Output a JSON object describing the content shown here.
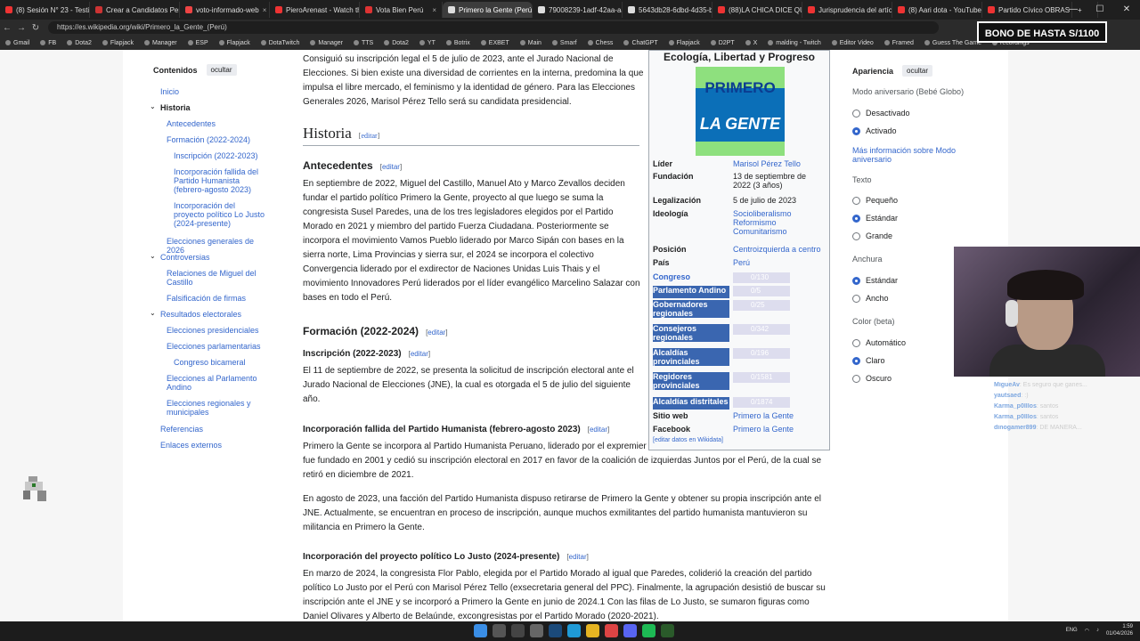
{
  "browser": {
    "tabs": [
      {
        "label": "(8) Sesión N° 23 - Testim...",
        "color": "#e33"
      },
      {
        "label": "Crear a Candidatos Per...",
        "color": "#c33"
      },
      {
        "label": "voto-informado-web",
        "color": "#e44"
      },
      {
        "label": "PieroArenast - Watch the...",
        "color": "#e33"
      },
      {
        "label": "Vota Bien Perú",
        "color": "#d33"
      },
      {
        "label": "Primero la Gente (Perú)",
        "color": "#ddd",
        "active": true
      },
      {
        "label": "79008239-1adf-42aa-aa6...",
        "color": "#ddd"
      },
      {
        "label": "5643db28-6dbd-4d35-b...",
        "color": "#ddd"
      },
      {
        "label": "(88)LA CHICA DICE QUE...",
        "color": "#e33"
      },
      {
        "label": "Jurisprudencia del artícul...",
        "color": "#e33"
      },
      {
        "label": "(8) Aari dota - YouTube",
        "color": "#e33"
      },
      {
        "label": "Partido Cívico OBRAS - V...",
        "color": "#e33"
      }
    ],
    "url": "https://es.wikipedia.org/wiki/Primero_la_Gente_(Perú)",
    "bookmarks": [
      "Gmail",
      "FB",
      "Dota2",
      "Flapjack",
      "Manager",
      "ESP",
      "Flapjack",
      "DotaTwitch",
      "Manager",
      "TTS",
      "Dota2",
      "YT",
      "Botrix",
      "EXBET",
      "Main",
      "Smarf",
      "Chess",
      "ChatGPT",
      "Flapjack",
      "D2PT",
      "X",
      "malding - Twitch",
      "Editor Video",
      "Framed",
      "Guess The Game",
      "recordings"
    ],
    "overlay_banner": "BONO DE HASTA S/1100"
  },
  "toc": {
    "title": "Contenidos",
    "hide": "ocultar",
    "items": [
      "Inicio",
      "Historia",
      "Antecedentes",
      "Formación (2022-2024)",
      "Inscripción (2022-2023)",
      "Incorporación fallida del Partido Humanista (febrero-agosto 2023)",
      "Incorporación del proyecto político Lo Justo (2024-presente)",
      "Elecciones generales de 2026",
      "Controversias",
      "Relaciones de Miguel del Castillo",
      "Falsificación de firmas",
      "Resultados electorales",
      "Elecciones presidenciales",
      "Elecciones parlamentarias",
      "Congreso bicameral",
      "Elecciones al Parlamento Andino",
      "Elecciones regionales y municipales",
      "Referencias",
      "Enlaces externos"
    ]
  },
  "article": {
    "intro": "Consiguió su inscripción legal el 5 de julio de 2023, ante el Jurado Nacional de Elecciones. Si bien existe una diversidad de corrientes en la interna, predomina la que impulsa el libre mercado, el feminismo y la identidad de género. Para las Elecciones Generales 2026, Marisol Pérez Tello será su candidata presidencial.",
    "edit": "editar",
    "h_historia": "Historia",
    "h_antecedentes": "Antecedentes",
    "p_antecedentes": "En septiembre de 2022, Miguel del Castillo, Manuel Ato y Marco Zevallos deciden fundar el partido político Primero la Gente, proyecto al que luego se suma la congresista Susel Paredes, una de los tres legisladores elegidos por el Partido Morado en 2021 y miembro del partido Fuerza Ciudadana. Posteriormente se incorpora el movimiento Vamos Pueblo liderado por Marco Sipán con bases en la sierra norte, Lima Provincias y sierra sur, el 2024 se incorpora el colectivo Convergencia liderado por el exdirector de Naciones Unidas Luis Thais y el movimiento Innovadores Perú liderados por el líder evangélico Marcelino Salazar con bases en todo el Perú.",
    "h_formacion": "Formación (2022-2024)",
    "h_inscripcion": "Inscripción (2022-2023)",
    "p_inscripcion": "El 11 de septiembre de 2022, se presenta la solicitud de inscripción electoral ante el Jurado Nacional de Elecciones (JNE), la cual es otorgada el 5 de julio del siguiente año.",
    "h_humanista": "Incorporación fallida del Partido Humanista (febrero-agosto 2023)",
    "p_humanista1": "Primero la Gente se incorpora al Partido Humanista Peruano, liderado por el expremier Yehude Simon, en febrero de 2023. El PHP fue fundado en 2001 y cedió su inscripción electoral en 2017 en favor de la coalición de izquierdas Juntos por el Perú, de la cual se retiró en diciembre de 2021.",
    "p_humanista2": "En agosto de 2023, una facción del Partido Humanista dispuso retirarse de Primero la Gente y obtener su propia inscripción ante el JNE. Actualmente, se encuentran en proceso de inscripción, aunque muchos exmilitantes del partido humanista mantuvieron su militancia en Primero la Gente.",
    "h_lojusto": "Incorporación del proyecto político Lo Justo (2024-presente)",
    "p_lojusto": "En marzo de 2024, la congresista Flor Pablo, elegida por el Partido Morado al igual que Paredes, coliderió la creación del partido político Lo Justo por el Perú con Marisol Pérez Tello (exsecretaria general del PPC). Finalmente, la agrupación desistió de buscar su inscripción ante el JNE y se incorporó a Primero la Gente en junio de 2024.1  Con las filas de Lo Justo, se sumaron figuras como",
    "p_cut": "Daniel Olivares y Alberto de Belaúnde, excongresistas por el Partido Morado (2020-2021)."
  },
  "infobox": {
    "title": "Ecología, Libertad y Progreso",
    "logo_line1": "PRIMERO",
    "logo_line2": "LA GENTE",
    "rows": [
      {
        "k": "Líder",
        "v": "Marisol Pérez Tello"
      },
      {
        "k": "Fundación",
        "v": "13 de septiembre de 2022 (3 años)"
      },
      {
        "k": "Legalización",
        "v": "5 de julio de 2023"
      },
      {
        "k": "Ideología",
        "v": "Socioliberalismo Reformismo Comunitarismo"
      },
      {
        "k": "Posición",
        "v": "Centroizquierda a centro"
      },
      {
        "k": "País",
        "v": "Perú"
      }
    ],
    "seats": [
      {
        "k": "Congreso",
        "v": "0/130"
      },
      {
        "k": "Parlamento Andino",
        "v": "0/5"
      },
      {
        "k": "Gobernadores regionales",
        "v": "0/25"
      },
      {
        "k": "Consejeros regionales",
        "v": "0/342"
      },
      {
        "k": "Alcaldías provinciales",
        "v": "0/196"
      },
      {
        "k": "Regidores provinciales",
        "v": "0/1581"
      },
      {
        "k": "Alcaldías distritales",
        "v": "0/1874"
      }
    ],
    "links": [
      {
        "k": "Sitio web",
        "v": "Primero la Gente"
      },
      {
        "k": "Facebook",
        "v": "Primero la Gente"
      }
    ],
    "edit_wikidata": "[editar datos en Wikidata]"
  },
  "appearance": {
    "title": "Apariencia",
    "hide": "ocultar",
    "anniv_label": "Modo aniversario (Bebé Globo)",
    "anniv_opts": [
      "Desactivado",
      "Activado"
    ],
    "anniv_selected": 1,
    "more": "Más información sobre Modo aniversario",
    "text_label": "Texto",
    "text_opts": [
      "Pequeño",
      "Estándar",
      "Grande"
    ],
    "text_selected": 1,
    "width_label": "Anchura",
    "width_opts": [
      "Estándar",
      "Ancho"
    ],
    "width_selected": 0,
    "color_label": "Color (beta)",
    "color_opts": [
      "Automático",
      "Claro",
      "Oscuro"
    ],
    "color_selected": 1
  },
  "stream_chat": [
    {
      "user": "MigueAv",
      "msg": ": Es seguro que ganes..."
    },
    {
      "user": "yautsaed",
      "msg": ": :)"
    },
    {
      "user": "Karma_p0lllos",
      "msg": ": santos"
    },
    {
      "user": "Karma_p0lllos",
      "msg": ": santos"
    },
    {
      "user": "dinogamer899",
      "msg": ": DE MANERA..."
    }
  ],
  "taskbar": {
    "lang": "ENG",
    "time": "1:59",
    "date": "01/04/2026"
  }
}
